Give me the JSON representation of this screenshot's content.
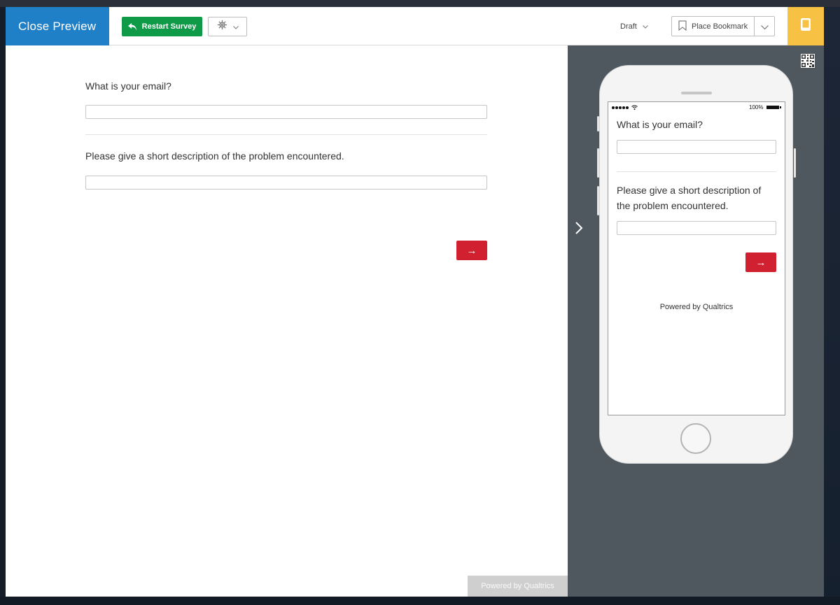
{
  "header": {
    "close_preview": "Close Preview",
    "restart_survey": "Restart Survey",
    "draft": "Draft",
    "place_bookmark": "Place Bookmark"
  },
  "colors": {
    "close_preview_bg": "#1f7fc7",
    "restart_bg": "#0f9a48",
    "device_toggle_bg": "#f7c244",
    "next_button_bg": "#d1202f",
    "mobile_pane_bg": "#4f575f"
  },
  "icons": {
    "restart": "undo-arrow-icon",
    "settings": "gear-icon",
    "bookmark": "bookmark-icon",
    "device": "mobile-device-icon",
    "collapse": "chevron-right-icon",
    "qr": "qr-code-icon"
  },
  "survey": {
    "questions": [
      {
        "label": "What is your email?",
        "value": ""
      },
      {
        "label": "Please give a short description of the problem encountered.",
        "value": ""
      }
    ],
    "next_label": "→",
    "powered_by": "Powered by Qualtrics"
  },
  "mobile": {
    "battery": "100%",
    "questions": [
      {
        "label": "What is your email?",
        "value": ""
      },
      {
        "label": "Please give a short description of the problem encountered.",
        "value": ""
      }
    ],
    "next_label": "→",
    "powered_by": "Powered by Qualtrics"
  }
}
